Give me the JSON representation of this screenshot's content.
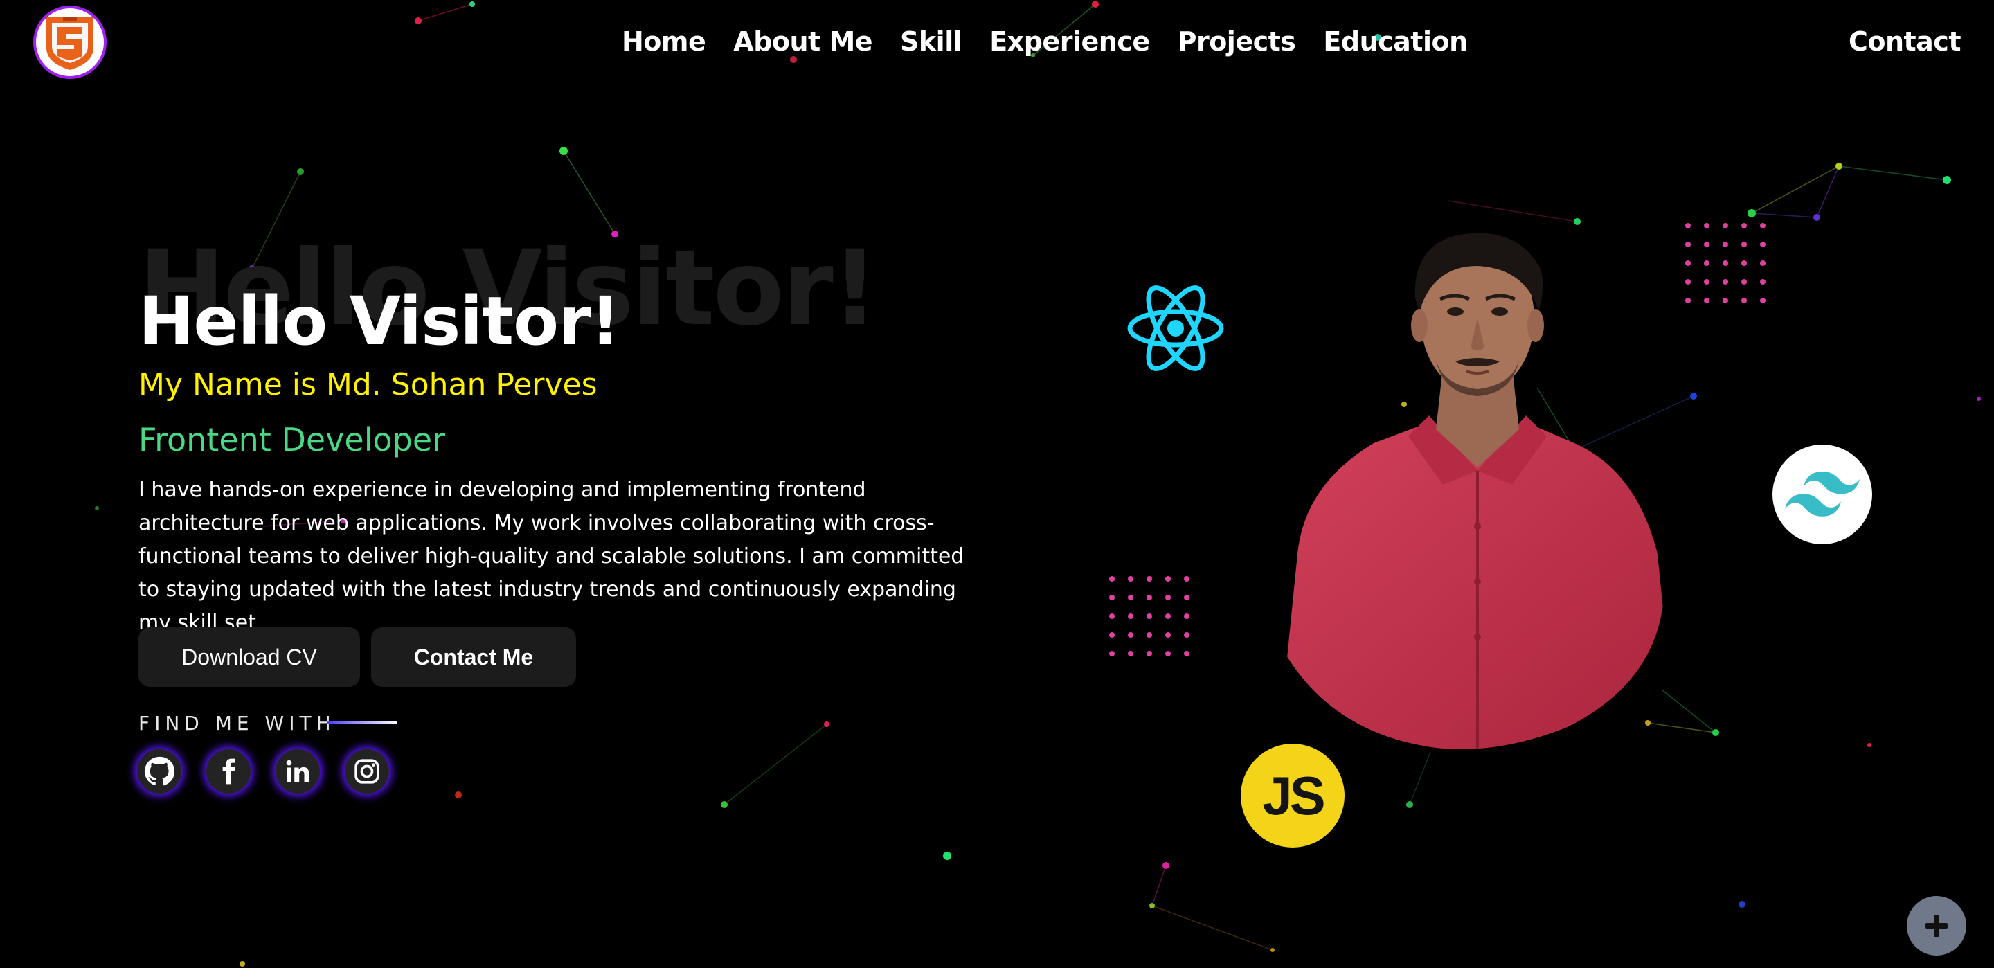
{
  "header": {
    "logo_icon": "brand-shield-logo",
    "nav": [
      {
        "label": "Home"
      },
      {
        "label": "About Me"
      },
      {
        "label": "Skill"
      },
      {
        "label": "Experience"
      },
      {
        "label": "Projects"
      },
      {
        "label": "Education"
      }
    ],
    "contact_label": "Contact"
  },
  "hero": {
    "ghost_title": "Hello Visitor!",
    "title": "Hello Visitor!",
    "name_line": "My Name is Md. Sohan Perves",
    "role": "Frontent Developer",
    "description": "I have hands-on experience in developing and implementing frontend architecture for web applications. My work involves collaborating with cross-functional teams to deliver high-quality and scalable solutions. I am committed to staying updated with the latest industry trends and continuously expanding my skill set.",
    "buttons": {
      "download_cv": "Download CV",
      "contact_me": "Contact Me"
    },
    "find_me_label": "FIND ME WITH",
    "socials": [
      {
        "icon": "github-icon"
      },
      {
        "icon": "facebook-icon"
      },
      {
        "icon": "linkedin-icon"
      },
      {
        "icon": "instagram-icon"
      }
    ]
  },
  "illustration": {
    "js_badge_text": "JS",
    "icons": [
      "react-icon",
      "tailwind-icon",
      "javascript-icon"
    ],
    "shirt_color": "#c9354f",
    "dot_color": "#e040a0"
  },
  "colors": {
    "background": "#000000",
    "name_yellow": "#fff200",
    "role_green": "#4ad887",
    "react_cyan": "#1ed6ff",
    "js_yellow": "#f4d418",
    "tailwind_teal": "#38bdc8",
    "glow_purple": "#5a18ff"
  },
  "fab_icon": "plus-icon"
}
